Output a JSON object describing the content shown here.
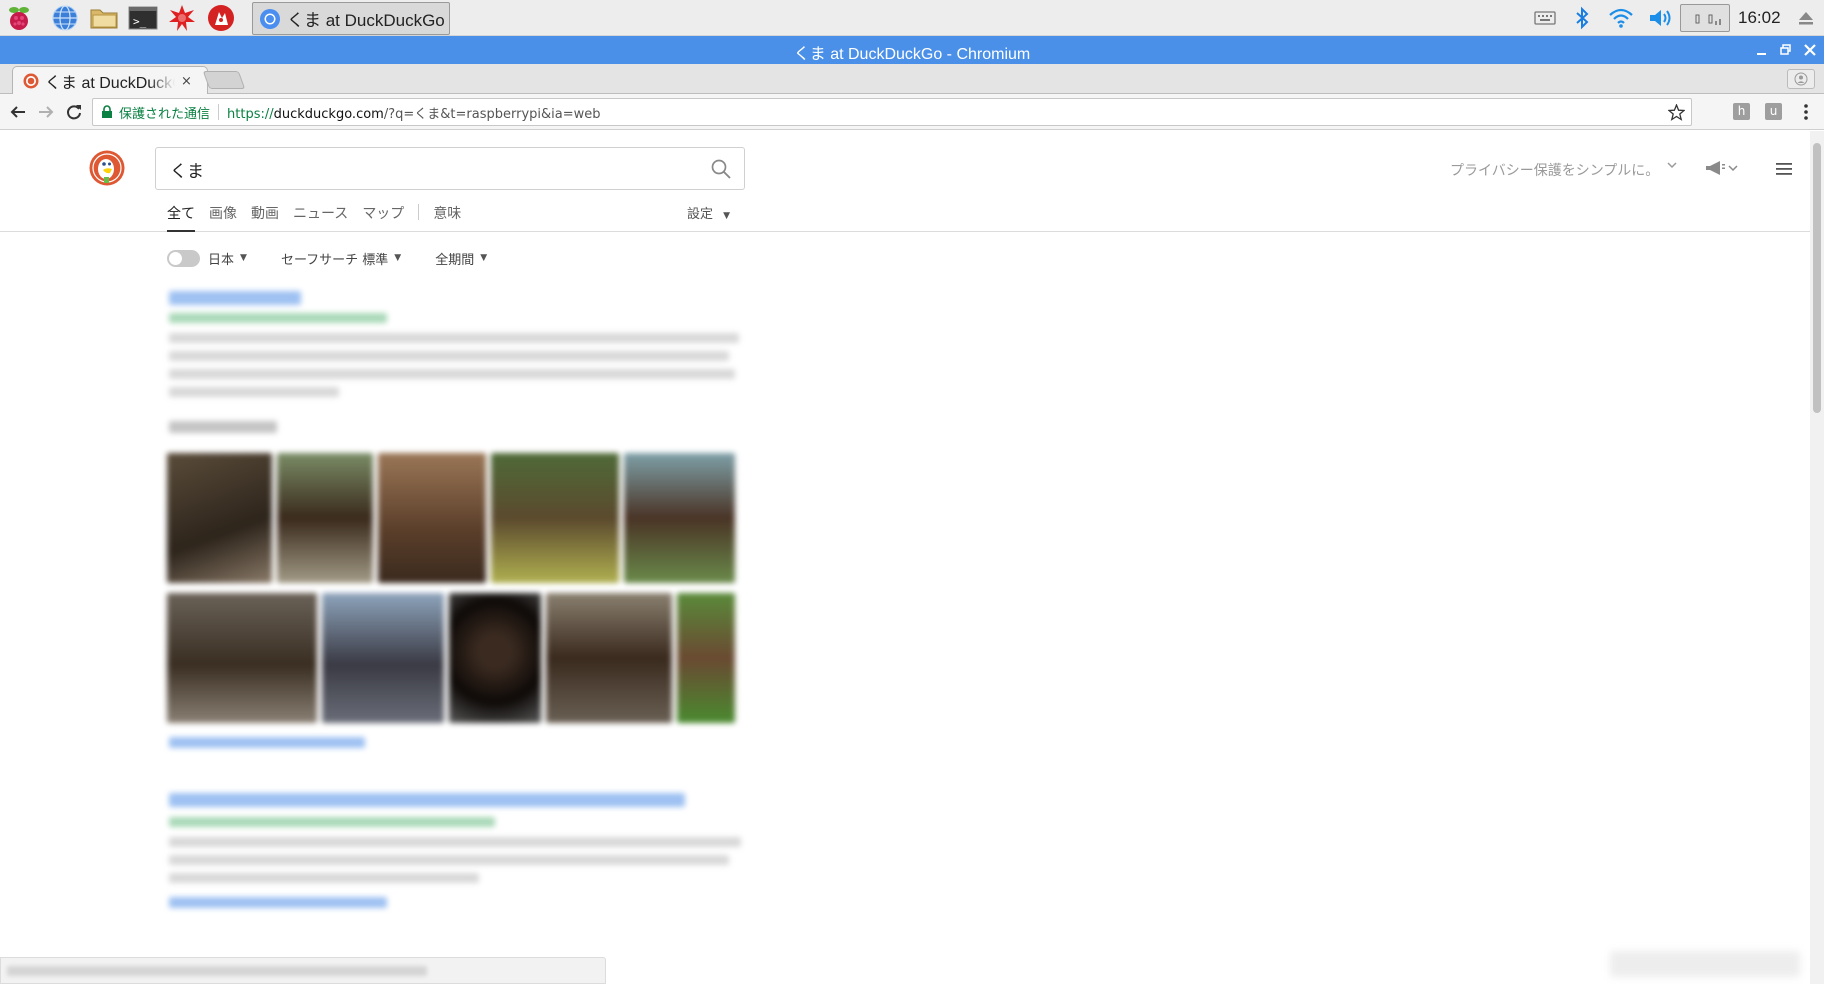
{
  "taskbar": {
    "active_task": "くま at DuckDuckGo ...",
    "clock": "16:02"
  },
  "window": {
    "title": "くま at DuckDuckGo - Chromium"
  },
  "tab": {
    "title": "くま at DuckDuckGo",
    "close": "×"
  },
  "omnibox": {
    "secure_label": "保護された通信",
    "scheme": "https://",
    "host": "duckduckgo.com",
    "path": "/?q=くま&t=raspberrypi&ia=web"
  },
  "extensions": [
    "h",
    "u"
  ],
  "ddg": {
    "query": "くま",
    "tagline": "プライバシー保護をシンプルに。",
    "tabs": [
      "全て",
      "画像",
      "動画",
      "ニュース",
      "マップ"
    ],
    "meaning_tab": "意味",
    "settings": "設定",
    "filters": {
      "region": "日本",
      "safe_search": "セーフサーチ 標準",
      "time": "全期間"
    }
  },
  "colors": {
    "title_bar": "#4a90e8",
    "secure_green": "#0b8043",
    "ddg_orange": "#de5833"
  }
}
